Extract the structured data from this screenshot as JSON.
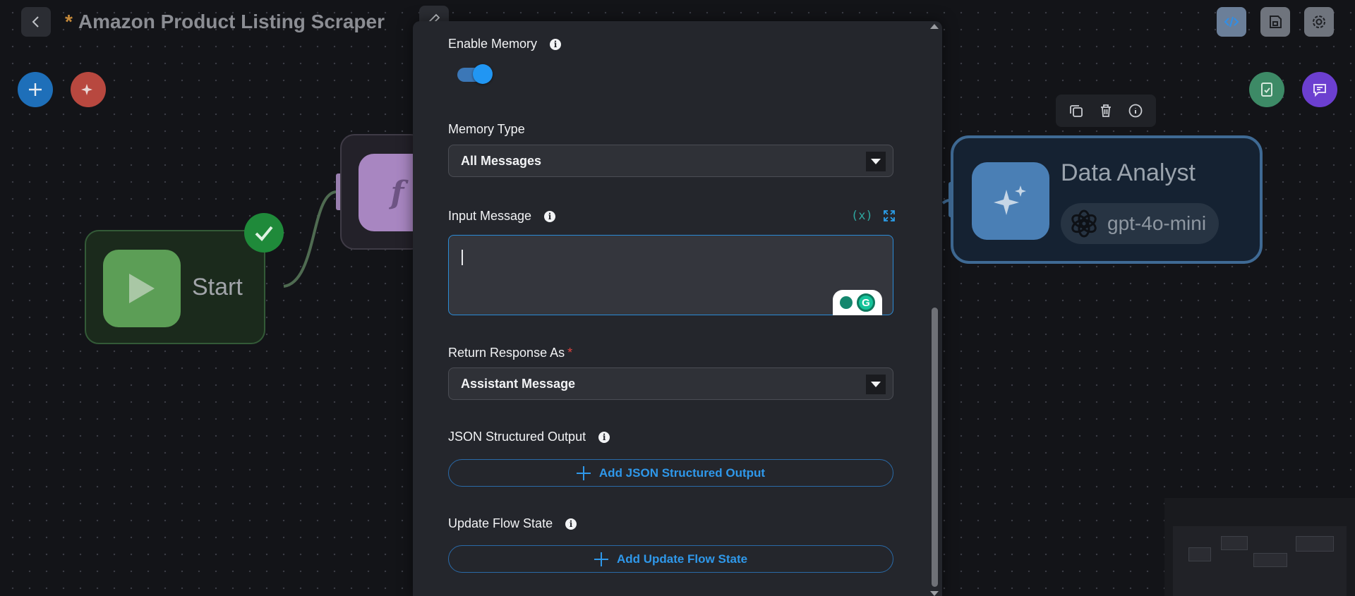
{
  "header": {
    "unsaved_marker": "*",
    "title": "Amazon Product Listing Scraper"
  },
  "nodes": {
    "start": {
      "label": "Start"
    },
    "function": {
      "glyph": "f"
    },
    "agent": {
      "name": "Data Analyst",
      "model": "gpt-4o-mini"
    }
  },
  "panel": {
    "enable_memory": {
      "label": "Enable Memory",
      "enabled": true
    },
    "memory_type": {
      "label": "Memory Type",
      "value": "All Messages"
    },
    "input_message": {
      "label": "Input Message",
      "value": "",
      "variable_icon": "(x)"
    },
    "return_response": {
      "label": "Return Response As",
      "required_marker": "*",
      "value": "Assistant Message"
    },
    "json_output": {
      "label": "JSON Structured Output",
      "button": "Add JSON Structured Output"
    },
    "update_flow_state": {
      "label": "Update Flow State",
      "button": "Add Update Flow State"
    }
  },
  "colors": {
    "accent": "#2196f3",
    "start_node": "#5c9e56",
    "agent_node": "#4a7fb5",
    "function_node": "#a886c1",
    "required": "#e0443f"
  }
}
